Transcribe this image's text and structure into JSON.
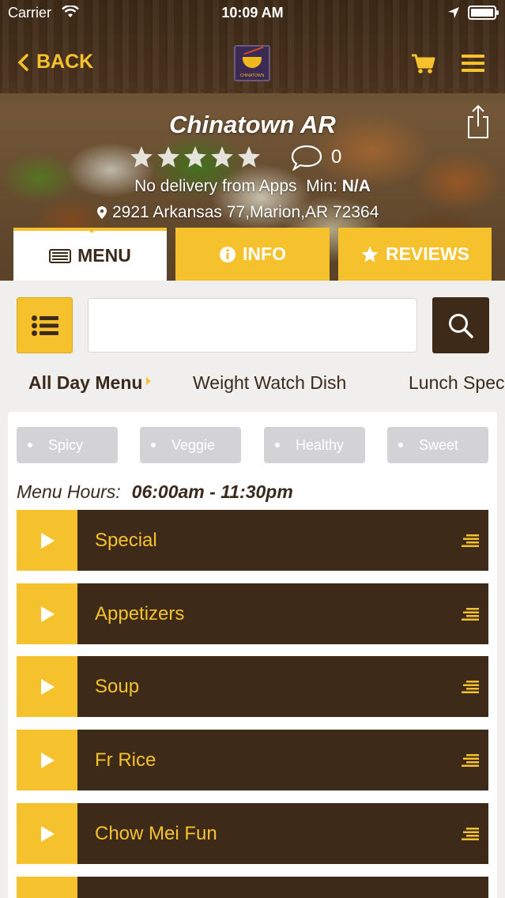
{
  "status_bar": {
    "carrier": "Carrier",
    "time": "10:09 AM"
  },
  "nav": {
    "back_label": "BACK"
  },
  "restaurant": {
    "name": "Chinatown AR",
    "review_count": "0",
    "delivery_text": "No delivery from Apps",
    "min_label": "Min:",
    "min_value": "N/A",
    "address": "2921 Arkansas 77,Marion,AR 72364"
  },
  "tabs": [
    {
      "label": "MENU"
    },
    {
      "label": "INFO"
    },
    {
      "label": "REVIEWS"
    }
  ],
  "search": {
    "value": "",
    "placeholder": ""
  },
  "categories": [
    {
      "label": "All Day Menu"
    },
    {
      "label": "Weight Watch Dish"
    },
    {
      "label": "Lunch Spec"
    }
  ],
  "filters": [
    {
      "label": "Spicy"
    },
    {
      "label": "Veggie"
    },
    {
      "label": "Healthy"
    },
    {
      "label": "Sweet"
    }
  ],
  "menu_hours": {
    "label": "Menu Hours:",
    "value": "06:00am - 11:30pm"
  },
  "menu_sections": [
    {
      "label": "Special"
    },
    {
      "label": "Appetizers"
    },
    {
      "label": "Soup"
    },
    {
      "label": "Fr Rice"
    },
    {
      "label": "Chow Mei Fun"
    }
  ],
  "colors": {
    "accent": "#f5c22e",
    "dark_brown": "#3d2a19",
    "chip_gray": "#d3d3d6"
  }
}
